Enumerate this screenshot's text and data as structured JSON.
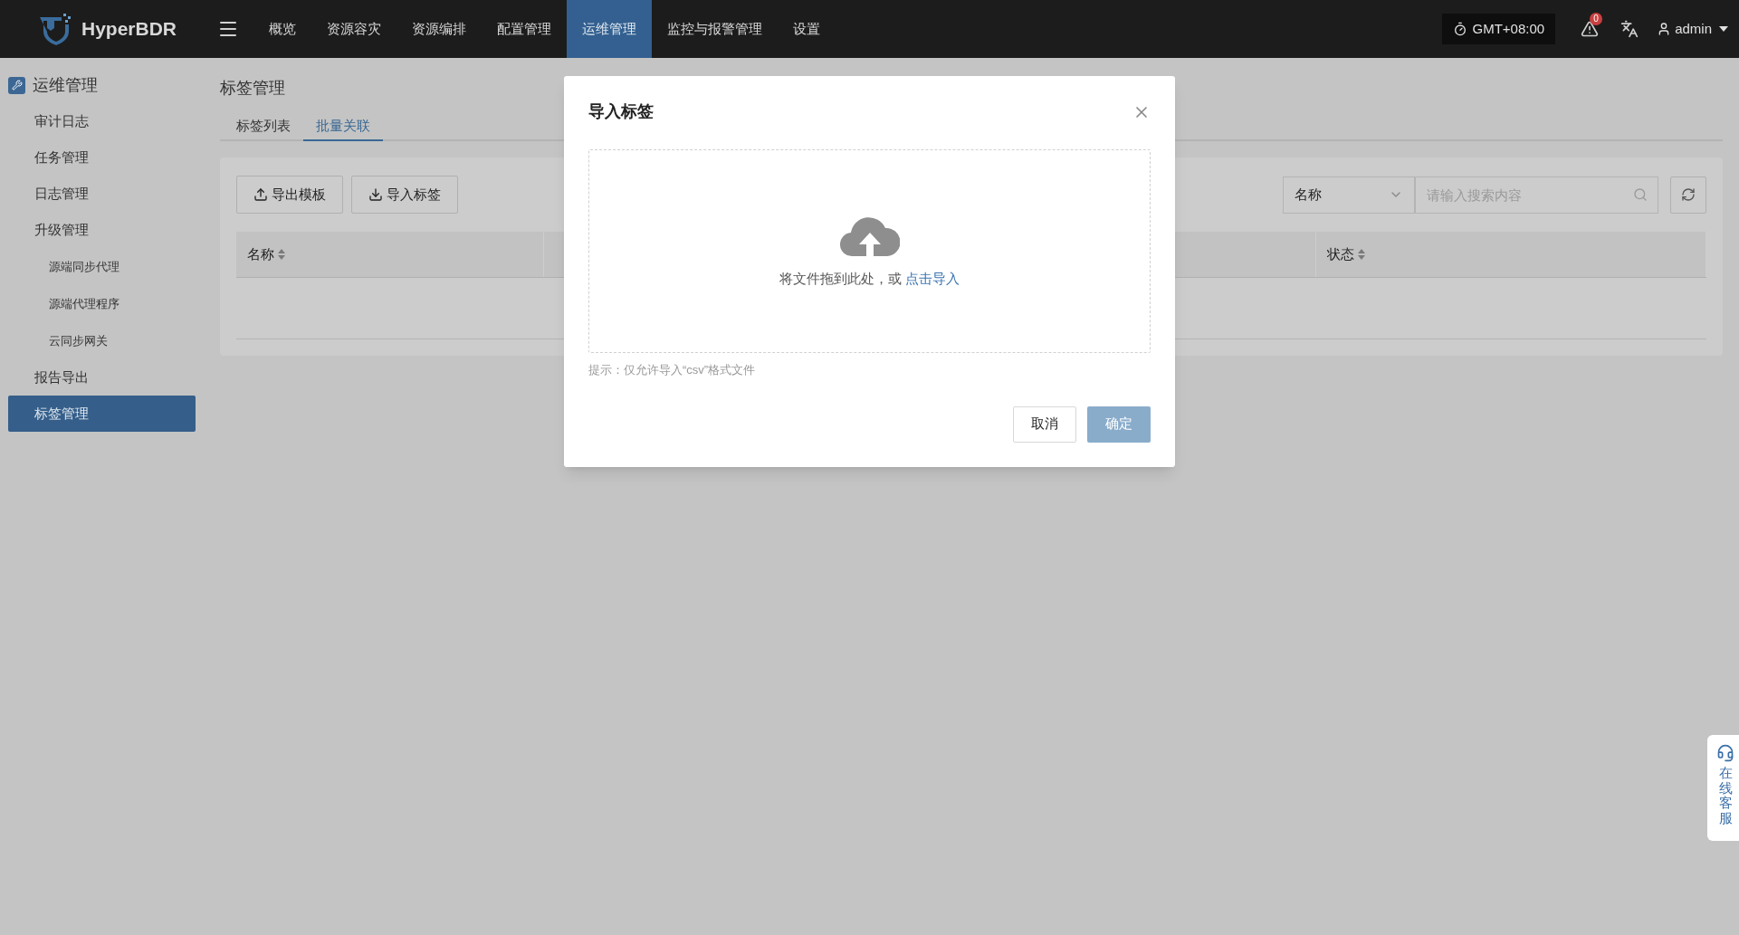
{
  "topbar": {
    "logo": "HyperBDR",
    "nav": [
      {
        "label": "概览",
        "selected": false
      },
      {
        "label": "资源容灾",
        "selected": false
      },
      {
        "label": "资源编排",
        "selected": false
      },
      {
        "label": "配置管理",
        "selected": false
      },
      {
        "label": "运维管理",
        "selected": true
      },
      {
        "label": "监控与报警管理",
        "selected": false
      },
      {
        "label": "设置",
        "selected": false
      }
    ],
    "timezone": "GMT+08:00",
    "alert_count": "0",
    "user": "admin"
  },
  "sidebar": {
    "title": "运维管理",
    "items": [
      {
        "label": "审计日志",
        "selected": false
      },
      {
        "label": "任务管理",
        "selected": false
      },
      {
        "label": "日志管理",
        "selected": false
      },
      {
        "label": "升级管理",
        "selected": false,
        "children": [
          {
            "label": "源端同步代理",
            "selected": false
          },
          {
            "label": "源端代理程序",
            "selected": false
          },
          {
            "label": "云同步网关",
            "selected": false
          }
        ]
      },
      {
        "label": "报告导出",
        "selected": false
      },
      {
        "label": "标签管理",
        "selected": true
      }
    ]
  },
  "page": {
    "title": "标签管理",
    "tabs": [
      {
        "label": "标签列表",
        "selected": false
      },
      {
        "label": "批量关联",
        "selected": true
      }
    ],
    "buttons": [
      {
        "kind": "upload",
        "label": "导出模板"
      },
      {
        "kind": "download",
        "label": "导入标签"
      }
    ],
    "search": {
      "field": "名称",
      "placeholder": "请输入搜索内容"
    },
    "table": {
      "columns": [
        {
          "label": "名称",
          "sortable": true
        },
        {
          "sortable": false
        },
        {
          "label": "状态",
          "sortable": true
        }
      ]
    }
  },
  "dialog": {
    "title": "导入标签",
    "drop_text": "将文件拖到此处，或",
    "drop_link": "点击导入",
    "hint": "提示：仅允许导入“csv”格式文件",
    "buttons": [
      {
        "kind": "secondary",
        "label": "取消"
      },
      {
        "kind": "primary",
        "label": "确定"
      }
    ]
  },
  "support": {
    "label": "在线客服"
  }
}
